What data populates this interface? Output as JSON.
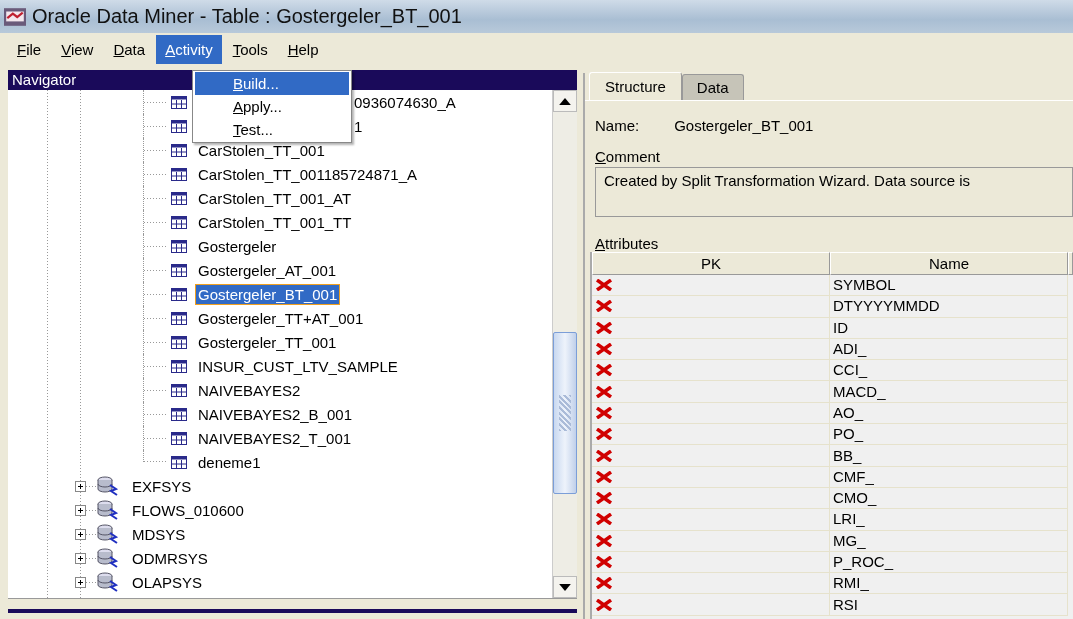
{
  "window": {
    "title": "Oracle Data Miner - Table : Gostergeler_BT_001"
  },
  "menu": [
    {
      "label": "File",
      "selected": false
    },
    {
      "label": "View",
      "selected": false
    },
    {
      "label": "Data",
      "selected": false
    },
    {
      "label": "Activity",
      "selected": true
    },
    {
      "label": "Tools",
      "selected": false
    },
    {
      "label": "Help",
      "selected": false
    }
  ],
  "dropdown": {
    "items": [
      {
        "label": "Build...",
        "selected": true
      },
      {
        "label": "Apply...",
        "selected": false
      },
      {
        "label": "Test...",
        "selected": false
      }
    ]
  },
  "navigator": {
    "title": "Navigator",
    "items": [
      {
        "kind": "covered",
        "label": "0936074630_A",
        "selected": false
      },
      {
        "kind": "covered",
        "label": "1",
        "selected": false
      },
      {
        "kind": "table",
        "label": "CarStolen_TT_001",
        "selected": false
      },
      {
        "kind": "table",
        "label": "CarStolen_TT_001185724871_A",
        "selected": false
      },
      {
        "kind": "table",
        "label": "CarStolen_TT_001_AT",
        "selected": false
      },
      {
        "kind": "table",
        "label": "CarStolen_TT_001_TT",
        "selected": false
      },
      {
        "kind": "table",
        "label": "Gostergeler",
        "selected": false
      },
      {
        "kind": "table",
        "label": "Gostergeler_AT_001",
        "selected": false
      },
      {
        "kind": "table",
        "label": "Gostergeler_BT_001",
        "selected": true
      },
      {
        "kind": "table",
        "label": "Gostergeler_TT+AT_001",
        "selected": false
      },
      {
        "kind": "table",
        "label": "Gostergeler_TT_001",
        "selected": false
      },
      {
        "kind": "table",
        "label": "INSUR_CUST_LTV_SAMPLE",
        "selected": false
      },
      {
        "kind": "table",
        "label": "NAIVEBAYES2",
        "selected": false
      },
      {
        "kind": "table",
        "label": "NAIVEBAYES2_B_001",
        "selected": false
      },
      {
        "kind": "table",
        "label": "NAIVEBAYES2_T_001",
        "selected": false
      },
      {
        "kind": "table",
        "label": "deneme1",
        "selected": false
      },
      {
        "kind": "schema",
        "label": "EXFSYS",
        "expanded": false,
        "selected": false
      },
      {
        "kind": "schema",
        "label": "FLOWS_010600",
        "expanded": false,
        "selected": false
      },
      {
        "kind": "schema",
        "label": "MDSYS",
        "expanded": false,
        "selected": false
      },
      {
        "kind": "schema",
        "label": "ODMRSYS",
        "expanded": false,
        "selected": false
      },
      {
        "kind": "schema",
        "label": "OLAPSYS",
        "expanded": false,
        "selected": false
      }
    ]
  },
  "tabs": [
    {
      "label": "Structure",
      "selected": true
    },
    {
      "label": "Data",
      "selected": false
    }
  ],
  "name": {
    "label": "Name:",
    "value": "Gostergeler_BT_001"
  },
  "comment": {
    "label": "Comment",
    "value": "Created by Split Transformation Wizard. Data source is"
  },
  "attributes": {
    "label": "Attributes",
    "columns": [
      "PK",
      "Name"
    ],
    "rows": [
      {
        "pk": false,
        "name": "SYMBOL"
      },
      {
        "pk": false,
        "name": "DTYYYYMMDD"
      },
      {
        "pk": false,
        "name": "ID"
      },
      {
        "pk": false,
        "name": "ADI_"
      },
      {
        "pk": false,
        "name": "CCI_"
      },
      {
        "pk": false,
        "name": "MACD_"
      },
      {
        "pk": false,
        "name": "AO_"
      },
      {
        "pk": false,
        "name": "PO_"
      },
      {
        "pk": false,
        "name": "BB_"
      },
      {
        "pk": false,
        "name": "CMF_"
      },
      {
        "pk": false,
        "name": "CMO_"
      },
      {
        "pk": false,
        "name": "LRI_"
      },
      {
        "pk": false,
        "name": "MG_"
      },
      {
        "pk": false,
        "name": "P_ROC_"
      },
      {
        "pk": false,
        "name": "RMI_"
      },
      {
        "pk": false,
        "name": "RSI"
      }
    ]
  }
}
